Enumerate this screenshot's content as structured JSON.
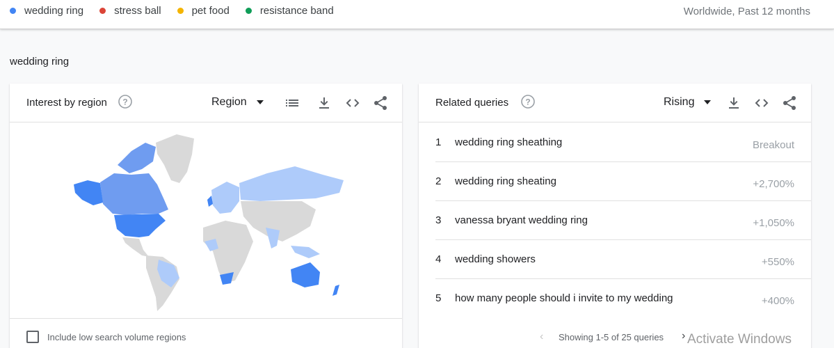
{
  "header": {
    "terms": [
      {
        "label": "wedding ring",
        "color": "#4285f4"
      },
      {
        "label": "stress ball",
        "color": "#db4437"
      },
      {
        "label": "pet food",
        "color": "#f4b400"
      },
      {
        "label": "resistance band",
        "color": "#0f9d58"
      }
    ],
    "scope": "Worldwide, Past 12 months"
  },
  "section": {
    "title": "wedding ring"
  },
  "interest_by_region": {
    "title": "Interest by region",
    "resolution": "Region",
    "checkbox_label": "Include low search volume regions",
    "icons": [
      "help-icon",
      "list-icon",
      "download-icon",
      "embed-icon",
      "share-icon"
    ],
    "map_colors": {
      "high": "#4285f4",
      "mid": "#6f9cf0",
      "low": "#aecbfa",
      "none": "#d9d9d9"
    }
  },
  "related_queries": {
    "title": "Related queries",
    "filter": "Rising",
    "rows": [
      {
        "rank": "1",
        "query": "wedding ring sheathing",
        "value": "Breakout"
      },
      {
        "rank": "2",
        "query": "wedding ring sheating",
        "value": "+2,700%"
      },
      {
        "rank": "3",
        "query": "vanessa bryant wedding ring",
        "value": "+1,050%"
      },
      {
        "rank": "4",
        "query": "wedding showers",
        "value": "+550%"
      },
      {
        "rank": "5",
        "query": "how many people should i invite to my wedding",
        "value": "+400%"
      }
    ],
    "pagination": "Showing 1-5 of 25 queries"
  },
  "watermark": "Activate Windows"
}
